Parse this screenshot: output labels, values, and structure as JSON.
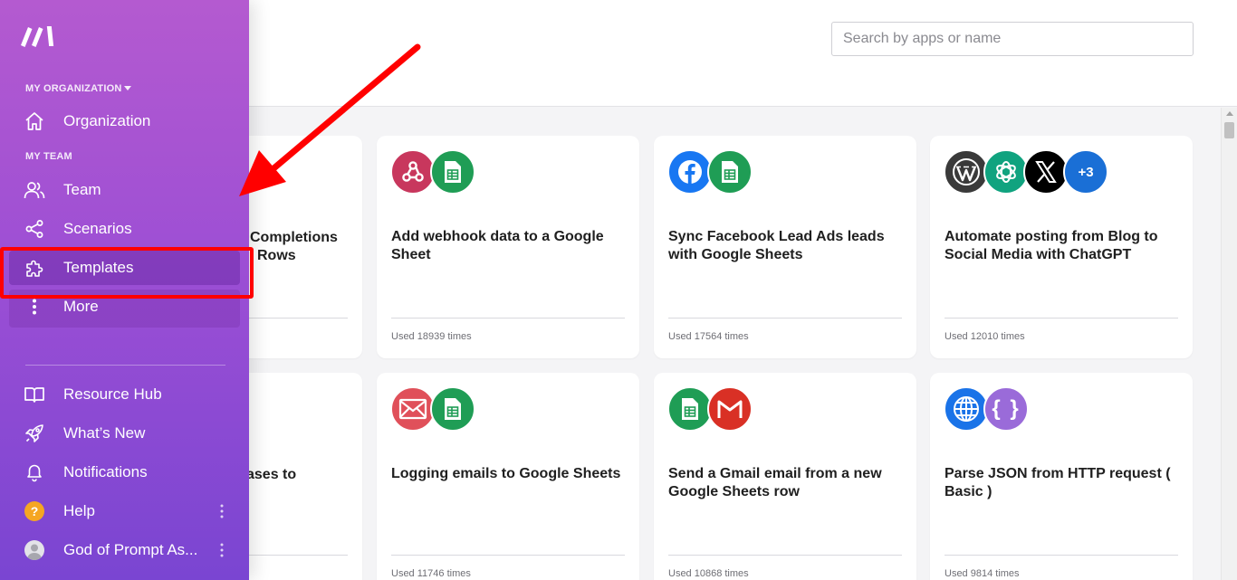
{
  "header": {
    "search_placeholder": "Search by apps or name"
  },
  "sidebar": {
    "org_section_label": "MY ORGANIZATION",
    "team_section_label": "MY TEAM",
    "items": {
      "organization": "Organization",
      "team": "Team",
      "scenarios": "Scenarios",
      "templates": "Templates",
      "more": "More",
      "resource_hub": "Resource Hub",
      "whats_new": "What’s New",
      "notifications": "Notifications",
      "help": "Help",
      "account": "God of Prompt As..."
    },
    "help_glyph": "?"
  },
  "partial_cards": {
    "top_line1": "Completions",
    "top_line2": "Rows",
    "bottom_line1": "ases to"
  },
  "templates": [
    {
      "title": "Add webhook data to a Google Sheet",
      "used": "Used 18939 times",
      "icons": [
        "webhook-icon",
        "google-sheets-icon"
      ]
    },
    {
      "title": "Sync Facebook Lead Ads leads with Google Sheets",
      "used": "Used 17564 times",
      "icons": [
        "facebook-icon",
        "google-sheets-icon"
      ]
    },
    {
      "title": "Automate posting from Blog to Social Media with ChatGPT",
      "used": "Used 12010 times",
      "icons": [
        "wordpress-icon",
        "openai-icon",
        "x-icon"
      ],
      "extra_count": "+3"
    },
    {
      "title": "Logging emails to Google Sheets",
      "used": "Used 11746 times",
      "icons": [
        "email-icon",
        "google-sheets-icon"
      ]
    },
    {
      "title": "Send a Gmail email from a new Google Sheets row",
      "used": "Used 10868 times",
      "icons": [
        "google-sheets-icon",
        "gmail-icon"
      ]
    },
    {
      "title": "Parse JSON from HTTP request ( Basic )",
      "used": "Used 9814 times",
      "icons": [
        "http-icon",
        "json-icon"
      ]
    }
  ],
  "colors": {
    "sidebar_top": "#b45ad0",
    "sidebar_bottom": "#7a45d2",
    "annotation": "#ff0000",
    "sheets_green": "#1f9d55",
    "webhook_pink": "#c8375d",
    "facebook_blue": "#1877f2",
    "openai_green": "#10a37f",
    "email_red": "#e0505a",
    "gmail_red": "#d93025",
    "http_blue": "#1a73e8",
    "json_purple": "#9a6bd9"
  }
}
